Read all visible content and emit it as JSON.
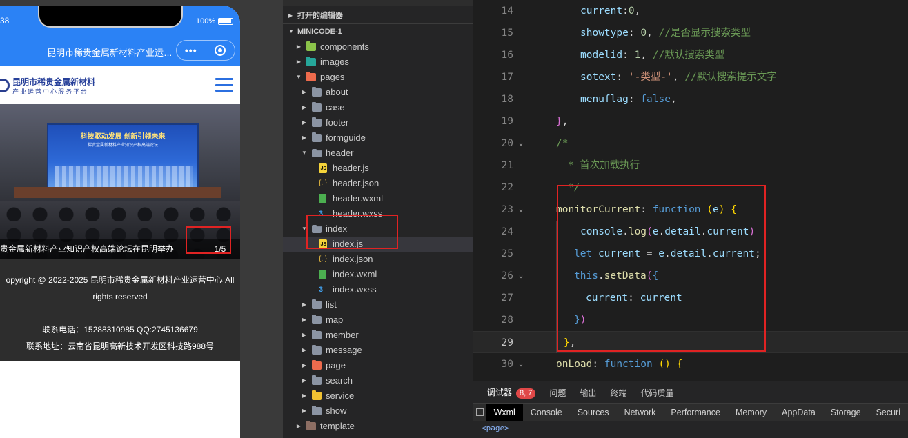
{
  "simulator": {
    "time": "38",
    "battery": "100%",
    "nav_title": "昆明市稀贵金属新材料产业运…",
    "capsule_more": "•••",
    "logo_cn": "昆明市稀贵金属新材料",
    "logo_sub": "产业运营中心服务平台",
    "banner": {
      "screen_title": "科技驱动发展  创新引领未来",
      "screen_sub": "稀贵金属新材料产业知识产权高端论坛",
      "caption": "贵金属新材料产业知识产权高端论坛在昆明举办",
      "counter": "1/5",
      "current_slide": 1,
      "total_slides": 5
    },
    "footer": {
      "copyright": "opyright @ 2022-2025 昆明市稀贵金属新材料产业运营中心 All rights reserved",
      "phone": "联系电话：15288310985 QQ:2745136679",
      "address": "联系地址：云南省昆明高新技术开发区科技路988号"
    }
  },
  "explorer": {
    "open_editors": "打开的编辑器",
    "project": "MINICODE-1",
    "tree": [
      {
        "name": "components",
        "depth": 1,
        "type": "folder",
        "color": "green",
        "expanded": false
      },
      {
        "name": "images",
        "depth": 1,
        "type": "folder",
        "color": "teal",
        "expanded": false
      },
      {
        "name": "pages",
        "depth": 1,
        "type": "folder",
        "color": "orange",
        "expanded": true
      },
      {
        "name": "about",
        "depth": 2,
        "type": "folder",
        "expanded": false
      },
      {
        "name": "case",
        "depth": 2,
        "type": "folder",
        "expanded": false
      },
      {
        "name": "footer",
        "depth": 2,
        "type": "folder",
        "expanded": false
      },
      {
        "name": "formguide",
        "depth": 2,
        "type": "folder",
        "expanded": false
      },
      {
        "name": "header",
        "depth": 2,
        "type": "folder",
        "expanded": true
      },
      {
        "name": "header.js",
        "depth": 3,
        "type": "js"
      },
      {
        "name": "header.json",
        "depth": 3,
        "type": "json"
      },
      {
        "name": "header.wxml",
        "depth": 3,
        "type": "wxml"
      },
      {
        "name": "header.wxss",
        "depth": 3,
        "type": "wxss"
      },
      {
        "name": "index",
        "depth": 2,
        "type": "folder",
        "expanded": true
      },
      {
        "name": "index.js",
        "depth": 3,
        "type": "js",
        "selected": true
      },
      {
        "name": "index.json",
        "depth": 3,
        "type": "json"
      },
      {
        "name": "index.wxml",
        "depth": 3,
        "type": "wxml"
      },
      {
        "name": "index.wxss",
        "depth": 3,
        "type": "wxss"
      },
      {
        "name": "list",
        "depth": 2,
        "type": "folder",
        "expanded": false
      },
      {
        "name": "map",
        "depth": 2,
        "type": "folder",
        "expanded": false
      },
      {
        "name": "member",
        "depth": 2,
        "type": "folder",
        "expanded": false
      },
      {
        "name": "message",
        "depth": 2,
        "type": "folder",
        "expanded": false
      },
      {
        "name": "page",
        "depth": 2,
        "type": "folder",
        "color": "orange",
        "expanded": false
      },
      {
        "name": "search",
        "depth": 2,
        "type": "folder",
        "expanded": false
      },
      {
        "name": "service",
        "depth": 2,
        "type": "folder",
        "color": "yellow",
        "expanded": false
      },
      {
        "name": "show",
        "depth": 2,
        "type": "folder",
        "expanded": false
      },
      {
        "name": "template",
        "depth": 1,
        "type": "folder",
        "color": "brown",
        "expanded": false
      }
    ]
  },
  "editor": {
    "active_line": 29,
    "lines": [
      {
        "n": "14",
        "code": "<span class='p'>current</span>:<span class='n'>0</span>,"
      },
      {
        "n": "15",
        "code": "<span class='p'>showtype</span>: <span class='n'>0</span>, <span class='c'>//是否显示搜索类型</span>"
      },
      {
        "n": "16",
        "code": "<span class='p'>modelid</span>: <span class='n'>1</span>, <span class='c'>//默认搜索类型</span>"
      },
      {
        "n": "17",
        "code": "<span class='p'>sotext</span>: <span class='s'>'-类型-'</span>, <span class='c'>//默认搜索提示文字</span>"
      },
      {
        "n": "18",
        "code": "<span class='p'>menuflag</span>: <span class='k'>false</span>,"
      },
      {
        "n": "19",
        "code": "<span class='b'>}</span>,"
      },
      {
        "n": "20",
        "code": "<span class='c'>/*</span>"
      },
      {
        "n": "21",
        "code": "<span class='c'> * 首次加载执行</span>"
      },
      {
        "n": "22",
        "code": "<span class='c'> */</span>"
      },
      {
        "n": "23",
        "code": "<span class='f'>monitorCurrent</span>: <span class='k'>function</span> <span class='y'>(</span><span class='p'>e</span><span class='y'>)</span> <span class='y'>{</span>"
      },
      {
        "n": "24",
        "code": "<span class='p'>console</span>.<span class='f'>log</span><span class='b'>(</span><span class='p'>e</span>.<span class='p'>detail</span>.<span class='p'>current</span><span class='b'>)</span>"
      },
      {
        "n": "25",
        "code": "<span class='k'>let</span> <span class='p'>current</span> = <span class='p'>e</span>.<span class='p'>detail</span>.<span class='p'>current</span>;"
      },
      {
        "n": "26",
        "code": "<span class='k'>this</span>.<span class='f'>setData</span><span class='b'>(</span><span class='k'>{</span>"
      },
      {
        "n": "27",
        "code": "<span class='p'>current</span>: <span class='p'>current</span>"
      },
      {
        "n": "28",
        "code": "<span class='k'>}</span><span class='b'>)</span>"
      },
      {
        "n": "29",
        "code": "<span class='y'>}</span>,"
      },
      {
        "n": "30",
        "code": "<span class='f'>onLoad</span>: <span class='k'>function</span> <span class='y'>()</span> <span class='y'>{</span>"
      }
    ]
  },
  "devtools": {
    "tabs": [
      "调试器",
      "问题",
      "输出",
      "终端",
      "代码质量"
    ],
    "badge": "8, 7",
    "panels": [
      "Wxml",
      "Console",
      "Sources",
      "Network",
      "Performance",
      "Memory",
      "AppData",
      "Storage",
      "Securi"
    ],
    "active_panel": "Wxml",
    "body": "<page>"
  },
  "colors": {
    "sim_blue": "#2b82f5",
    "highlight_red": "#e02323",
    "editor_bg": "#1e1e1e",
    "sidebar_bg": "#252526"
  }
}
